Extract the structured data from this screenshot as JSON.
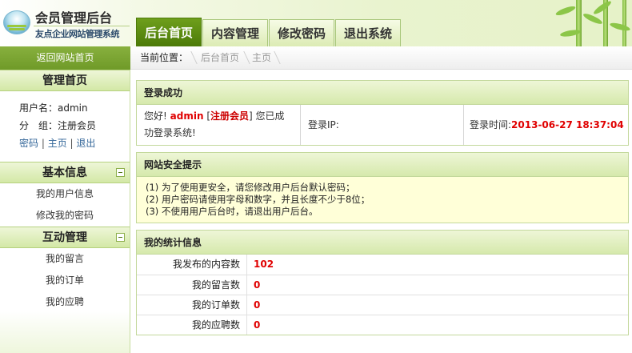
{
  "app": {
    "title": "会员管理后台",
    "subtitle": "友点企业网站管理系统"
  },
  "top_tabs": [
    {
      "label": "后台首页",
      "active": true
    },
    {
      "label": "内容管理",
      "active": false
    },
    {
      "label": "修改密码",
      "active": false
    },
    {
      "label": "退出系统",
      "active": false
    }
  ],
  "back_link": "返回网站首页",
  "breadcrumb": {
    "label": "当前位置：",
    "items": [
      "后台首页",
      "主页"
    ]
  },
  "sidebar": {
    "home_title": "管理首页",
    "username_label": "用户名：",
    "username": "admin",
    "group_label": "分　组：",
    "group": "注册会员",
    "links": [
      "密码",
      "主页",
      "退出"
    ],
    "sections": [
      {
        "title": "基本信息",
        "items": [
          "我的用户信息",
          "修改我的密码"
        ]
      },
      {
        "title": "互动管理",
        "items": [
          "我的留言",
          "我的订单",
          "我的应聘"
        ]
      }
    ]
  },
  "login_panel": {
    "title": "登录成功",
    "greeting_prefix": "您好! ",
    "user": "admin",
    "group_open": " [",
    "group": "注册会员",
    "group_close": "] ",
    "message": "您已成功登录系统!",
    "ip_label": "登录IP:",
    "ip_value": "",
    "time_label": "登录时间:",
    "time_value": "2013-06-27 18:37:04"
  },
  "security_panel": {
    "title": "网站安全提示",
    "tips": [
      "(1) 为了使用更安全，请您修改用户后台默认密码；",
      "(2) 用户密码请使用字母和数字，并且长度不少于8位；",
      "(3) 不使用用户后台时，请退出用户后台。"
    ]
  },
  "stats_panel": {
    "title": "我的统计信息",
    "rows": [
      {
        "label": "我发布的内容数",
        "value": "102"
      },
      {
        "label": "我的留言数",
        "value": "0"
      },
      {
        "label": "我的订单数",
        "value": "0"
      },
      {
        "label": "我的应聘数",
        "value": "0"
      }
    ]
  },
  "colors": {
    "accent_green": "#4c7a08",
    "highlight_red": "#e00000"
  }
}
